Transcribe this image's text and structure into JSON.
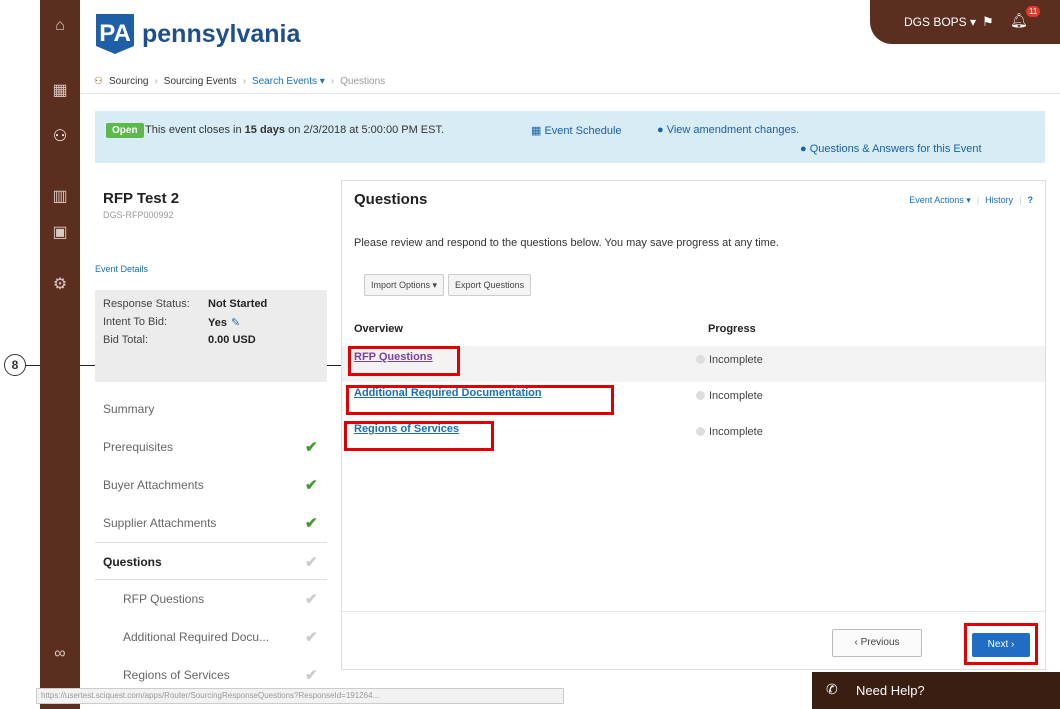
{
  "callout": "8",
  "rail": {
    "icons": [
      "home-icon",
      "layers-icon",
      "sourcing-icon",
      "chart-icon",
      "contracts-icon",
      "gear-icon",
      "binoculars-icon"
    ]
  },
  "header": {
    "logo_mark": "PA",
    "logo_text": "pennsylvania",
    "user": "DGS BOPS ▾",
    "notif_count": "11"
  },
  "breadcrumb": {
    "items": [
      "Sourcing",
      "Sourcing Events",
      "Search Events ▾",
      "Questions"
    ]
  },
  "banner": {
    "badge": "Open",
    "text_pre": "This event closes in ",
    "text_bold": "15 days",
    "text_post": " on 2/3/2018 at 5:00:00 PM EST.",
    "schedule": "Event Schedule",
    "amendment": "View amendment changes.",
    "qa": "Questions & Answers for this Event"
  },
  "event": {
    "title": "RFP Test 2",
    "id": "DGS-RFP000992",
    "details_link": "Event Details",
    "response_status_label": "Response Status:",
    "response_status": "Not Started",
    "intent_label": "Intent To Bid:",
    "intent": "Yes",
    "bid_total_label": "Bid Total:",
    "bid_total": "0.00 USD"
  },
  "nav": [
    {
      "label": "Summary",
      "check": ""
    },
    {
      "label": "Prerequisites",
      "check": "✔"
    },
    {
      "label": "Buyer Attachments",
      "check": "✔"
    },
    {
      "label": "Supplier Attachments",
      "check": "✔"
    },
    {
      "label": "Questions",
      "check": "✔"
    },
    {
      "label": "RFP Questions",
      "check": "✔"
    },
    {
      "label": "Additional Required Docu...",
      "check": "✔"
    },
    {
      "label": "Regions of Services",
      "check": "✔"
    }
  ],
  "main": {
    "title": "Questions",
    "event_actions": "Event Actions ▾",
    "history": "History",
    "help": "?",
    "description": "Please review and respond to the questions below. You may save progress at any time.",
    "import": "Import Options ▾",
    "export": "Export Questions",
    "col_overview": "Overview",
    "col_progress": "Progress",
    "rows": [
      {
        "name": "RFP Questions",
        "status": "Incomplete"
      },
      {
        "name": "Additional Required Documentation",
        "status": "Incomplete"
      },
      {
        "name": "Regions of Services",
        "status": "Incomplete"
      }
    ],
    "previous": "‹ Previous",
    "next": "Next ›"
  },
  "status_url": "https://usertest.sciquest.com/apps/Router/SourcingResponseQuestions?ResponseId=191264...",
  "help": "Need Help?"
}
